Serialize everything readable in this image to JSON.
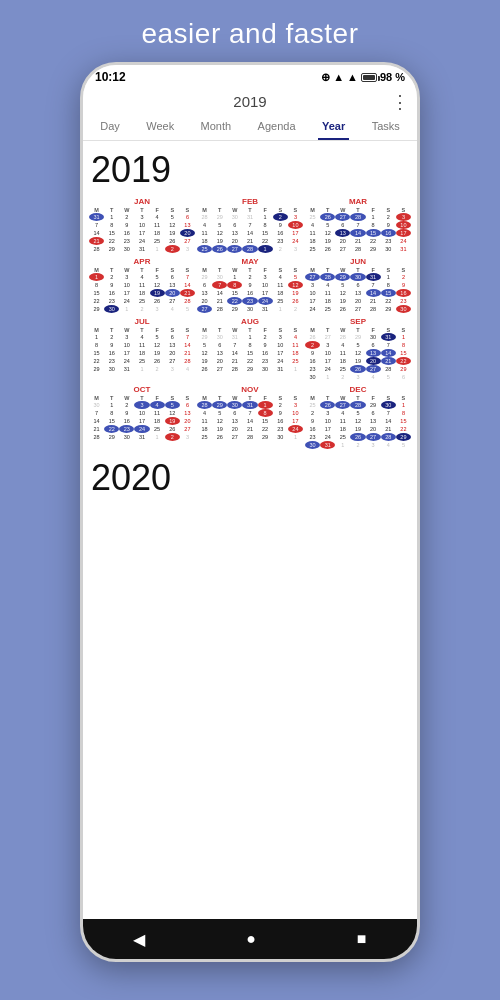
{
  "app": {
    "top_text": "easier and faster",
    "status": {
      "time": "10:12",
      "battery_pct": "98 %"
    },
    "header": {
      "year": "2019",
      "menu_icon": "⋮"
    },
    "nav_tabs": [
      "Day",
      "Week",
      "Month",
      "Agenda",
      "Year",
      "Tasks"
    ],
    "active_tab": "Year",
    "year_label": "2019",
    "next_year_label": "2020",
    "bottom_nav": {
      "back": "◀",
      "home": "●",
      "recents": "■"
    }
  }
}
